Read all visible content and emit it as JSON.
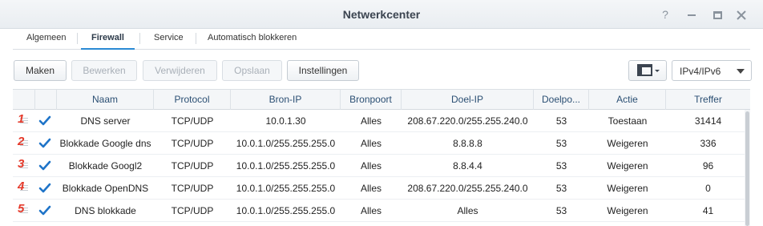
{
  "window": {
    "title": "Netwerkcenter",
    "controls": {
      "help": "?"
    }
  },
  "tabs": [
    {
      "label": "Algemeen",
      "active": false
    },
    {
      "label": "Firewall",
      "active": true
    },
    {
      "label": "Service",
      "active": false
    },
    {
      "label": "Automatisch blokkeren",
      "active": false
    }
  ],
  "toolbar": {
    "create": "Maken",
    "edit": "Bewerken",
    "delete": "Verwijderen",
    "save": "Opslaan",
    "settings": "Instellingen",
    "view_icon": "layout-view-icon",
    "ip_version": "IPv4/IPv6"
  },
  "grid": {
    "columns": [
      "Naam",
      "Protocol",
      "Bron-IP",
      "Bronpoort",
      "Doel-IP",
      "Doelpo...",
      "Actie",
      "Treffer"
    ],
    "rows": [
      {
        "num": "1",
        "checked": true,
        "name": "DNS server",
        "protocol": "TCP/UDP",
        "source_ip": "10.0.1.30",
        "source_port": "Alles",
        "dest_ip": "208.67.220.0/255.255.240.0",
        "dest_port": "53",
        "action": "Toestaan",
        "hits": "31414"
      },
      {
        "num": "2",
        "checked": true,
        "name": "Blokkade Google dns",
        "protocol": "TCP/UDP",
        "source_ip": "10.0.1.0/255.255.255.0",
        "source_port": "Alles",
        "dest_ip": "8.8.8.8",
        "dest_port": "53",
        "action": "Weigeren",
        "hits": "336"
      },
      {
        "num": "3",
        "checked": true,
        "name": "Blokkade Googl2",
        "protocol": "TCP/UDP",
        "source_ip": "10.0.1.0/255.255.255.0",
        "source_port": "Alles",
        "dest_ip": "8.8.4.4",
        "dest_port": "53",
        "action": "Weigeren",
        "hits": "96"
      },
      {
        "num": "4",
        "checked": true,
        "name": "Blokkade OpenDNS",
        "protocol": "TCP/UDP",
        "source_ip": "10.0.1.0/255.255.255.0",
        "source_port": "Alles",
        "dest_ip": "208.67.220.0/255.255.240.0",
        "dest_port": "53",
        "action": "Weigeren",
        "hits": "0"
      },
      {
        "num": "5",
        "checked": true,
        "name": "DNS blokkade",
        "protocol": "TCP/UDP",
        "source_ip": "10.0.1.0/255.255.255.0",
        "source_port": "Alles",
        "dest_ip": "Alles",
        "dest_port": "53",
        "action": "Weigeren",
        "hits": "41"
      }
    ]
  },
  "colors": {
    "accent": "#2a8ad4",
    "row_number": "#e53a2b",
    "checkmark": "#1f74c8",
    "header_text": "#2b4f73"
  }
}
